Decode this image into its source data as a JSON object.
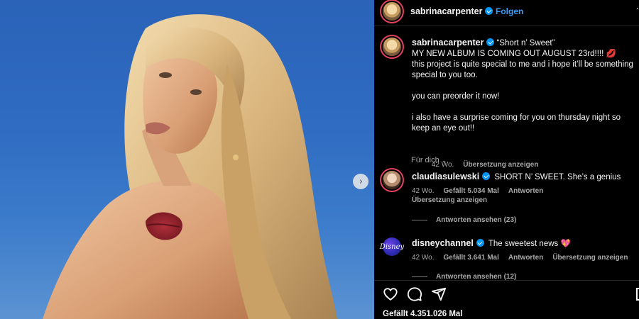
{
  "post": {
    "author": "sabrinacarpenter",
    "follow_label": "Folgen",
    "more_label": "·",
    "caption": "“Short n’ Sweet”\nMY NEW ALBUM IS COMING OUT AUGUST 23rd!!!! 💋\nthis project is quite special to me and i hope it’ll be something special to you too.\n\nyou can preorder it now!\n\ni also have a surprise coming for you on thursday night so keep an eye out!!",
    "caption_age": "42 Wo.",
    "caption_translate": "Übersetzung anzeigen",
    "for_you_label": "Für dich",
    "likes_label": "Gefällt 4.351.026 Mal"
  },
  "comments": [
    {
      "user": "claudiasulewski",
      "text": "SHORT N’ SWEET. She’s a genius",
      "age": "42 Wo.",
      "likes": "Gefällt 5.034 Mal",
      "reply": "Antworten",
      "translate": "Übersetzung anzeigen",
      "view_replies": "Antworten ansehen (23)"
    },
    {
      "user": "disneychannel",
      "avatar_text": "Disney",
      "text": "The sweetest news 💖",
      "age": "42 Wo.",
      "likes": "Gefällt 3.641 Mal",
      "reply": "Antworten",
      "translate": "Übersetzung anzeigen",
      "view_replies": "Antworten ansehen (12)"
    }
  ],
  "colors": {
    "follow": "#3a9df8",
    "verified": "#0095f6",
    "background": "#000000",
    "muted_text": "#a8a8a8",
    "sky": "#2f6cc2"
  },
  "icons": [
    "heart-icon",
    "comment-icon",
    "share-icon",
    "bookmark-icon",
    "chevron-right-icon",
    "chevron-down-icon",
    "verified-icon"
  ]
}
